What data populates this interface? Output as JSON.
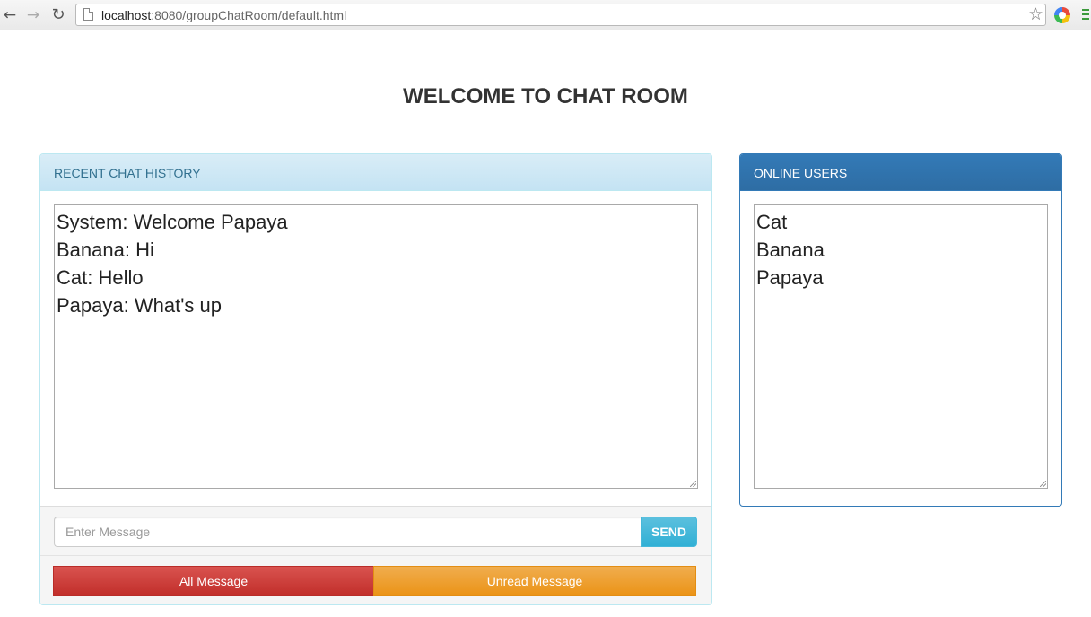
{
  "browser": {
    "url_host": "localhost",
    "url_rest": ":8080/groupChatRoom/default.html"
  },
  "page": {
    "title": "WELCOME TO CHAT ROOM"
  },
  "chat_panel": {
    "heading": "RECENT CHAT HISTORY",
    "messages": [
      "System: Welcome Papaya",
      "Banana: Hi",
      "Cat: Hello",
      "Papaya: What's up"
    ],
    "input_placeholder": "Enter Message",
    "input_value": "",
    "send_label": "SEND",
    "all_message_label": "All Message",
    "unread_message_label": "Unread Message"
  },
  "users_panel": {
    "heading": "ONLINE USERS",
    "users": [
      "Cat",
      "Banana",
      "Papaya"
    ]
  },
  "colors": {
    "chat_heading_bg": "#d9edf7",
    "users_heading_bg": "#337ab7",
    "send_button": "#5bc0de",
    "all_message_button": "#d9534f",
    "unread_message_button": "#f0ad4e"
  },
  "icons": {
    "back": "arrow-left-icon",
    "forward": "arrow-right-icon",
    "reload": "reload-icon",
    "page": "page-icon",
    "bookmark": "star-icon",
    "extension": "extension-icon",
    "menu": "menu-icon"
  }
}
